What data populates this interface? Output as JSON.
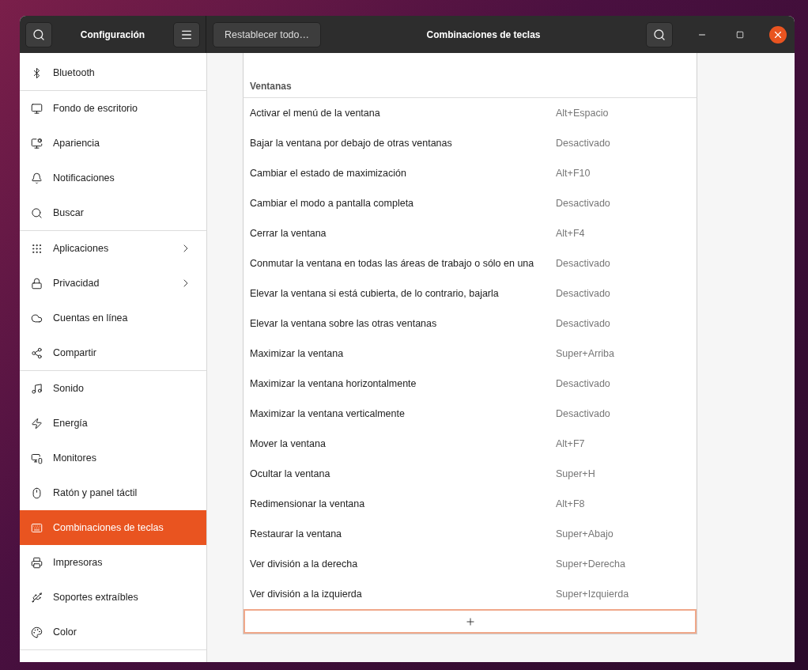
{
  "window": {
    "sidebar_title": "Configuración",
    "title": "Combinaciones de teclas",
    "reset_button": "Restablecer todo…"
  },
  "sidebar": {
    "groups": [
      {
        "items": [
          {
            "label": "Bluetooth",
            "selected": false,
            "submenu": false
          }
        ]
      },
      {
        "items": [
          {
            "label": "Fondo de escritorio",
            "selected": false,
            "submenu": false
          },
          {
            "label": "Apariencia",
            "selected": false,
            "submenu": false
          },
          {
            "label": "Notificaciones",
            "selected": false,
            "submenu": false
          },
          {
            "label": "Buscar",
            "selected": false,
            "submenu": false
          }
        ]
      },
      {
        "items": [
          {
            "label": "Aplicaciones",
            "selected": false,
            "submenu": true
          },
          {
            "label": "Privacidad",
            "selected": false,
            "submenu": true
          },
          {
            "label": "Cuentas en línea",
            "selected": false,
            "submenu": false
          },
          {
            "label": "Compartir",
            "selected": false,
            "submenu": false
          }
        ]
      },
      {
        "items": [
          {
            "label": "Sonido",
            "selected": false,
            "submenu": false
          },
          {
            "label": "Energía",
            "selected": false,
            "submenu": false
          },
          {
            "label": "Monitores",
            "selected": false,
            "submenu": false
          },
          {
            "label": "Ratón y panel táctil",
            "selected": false,
            "submenu": false
          },
          {
            "label": "Combinaciones de teclas",
            "selected": true,
            "submenu": false
          },
          {
            "label": "Impresoras",
            "selected": false,
            "submenu": false
          },
          {
            "label": "Soportes extraíbles",
            "selected": false,
            "submenu": false
          },
          {
            "label": "Color",
            "selected": false,
            "submenu": false
          }
        ]
      }
    ]
  },
  "shortcuts": {
    "section": "Ventanas",
    "rows": [
      {
        "action": "Activar el menú de la ventana",
        "shortcut": "Alt+Espacio"
      },
      {
        "action": "Bajar la ventana por debajo de otras ventanas",
        "shortcut": "Desactivado"
      },
      {
        "action": "Cambiar el estado de maximización",
        "shortcut": "Alt+F10"
      },
      {
        "action": "Cambiar el modo a pantalla completa",
        "shortcut": "Desactivado"
      },
      {
        "action": "Cerrar la ventana",
        "shortcut": "Alt+F4"
      },
      {
        "action": "Conmutar la ventana en todas las áreas de trabajo o sólo en una",
        "shortcut": "Desactivado"
      },
      {
        "action": "Elevar la ventana si está cubierta, de lo contrario, bajarla",
        "shortcut": "Desactivado"
      },
      {
        "action": "Elevar la ventana sobre las otras ventanas",
        "shortcut": "Desactivado"
      },
      {
        "action": "Maximizar la ventana",
        "shortcut": "Super+Arriba"
      },
      {
        "action": "Maximizar la ventana horizontalmente",
        "shortcut": "Desactivado"
      },
      {
        "action": "Maximizar la ventana verticalmente",
        "shortcut": "Desactivado"
      },
      {
        "action": "Mover la ventana",
        "shortcut": "Alt+F7"
      },
      {
        "action": "Ocultar la ventana",
        "shortcut": "Super+H"
      },
      {
        "action": "Redimensionar la ventana",
        "shortcut": "Alt+F8"
      },
      {
        "action": "Restaurar la ventana",
        "shortcut": "Super+Abajo"
      },
      {
        "action": "Ver división a la derecha",
        "shortcut": "Super+Derecha"
      },
      {
        "action": "Ver división a la izquierda",
        "shortcut": "Super+Izquierda"
      }
    ]
  }
}
